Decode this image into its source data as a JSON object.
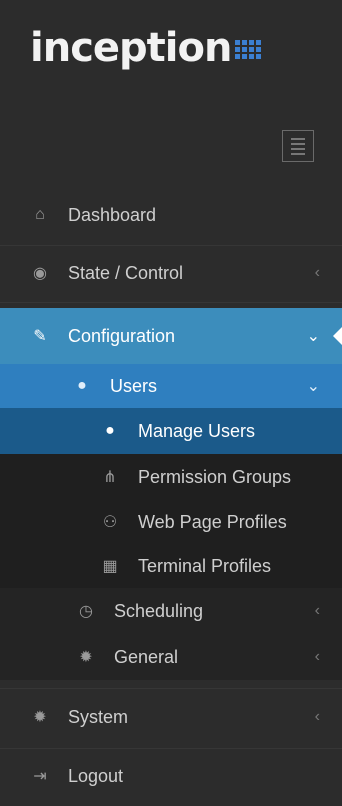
{
  "brand": {
    "name": "inception",
    "accent": "#3b7fd1"
  },
  "menu": {
    "dashboard": {
      "label": "Dashboard",
      "icon": "home-icon"
    },
    "state_control": {
      "label": "State / Control",
      "icon": "eye-icon"
    },
    "configuration": {
      "label": "Configuration",
      "icon": "edit-icon"
    },
    "users": {
      "label": "Users",
      "icon": "user-icon"
    },
    "manage_users": {
      "label": "Manage Users",
      "icon": "user-icon"
    },
    "permission_groups": {
      "label": "Permission Groups",
      "icon": "sitemap-icon"
    },
    "web_page_profiles": {
      "label": "Web Page Profiles",
      "icon": "users-icon"
    },
    "terminal_profiles": {
      "label": "Terminal Profiles",
      "icon": "keypad-icon"
    },
    "scheduling": {
      "label": "Scheduling",
      "icon": "clock-icon"
    },
    "general": {
      "label": "General",
      "icon": "gear-icon"
    },
    "system": {
      "label": "System",
      "icon": "gear-icon"
    },
    "logout": {
      "label": "Logout",
      "icon": "sign-out-icon"
    }
  },
  "colors": {
    "sidebar_bg": "#2c2c2c",
    "active": "#3c8dbc",
    "submenu_active": "#1b5a8a"
  }
}
